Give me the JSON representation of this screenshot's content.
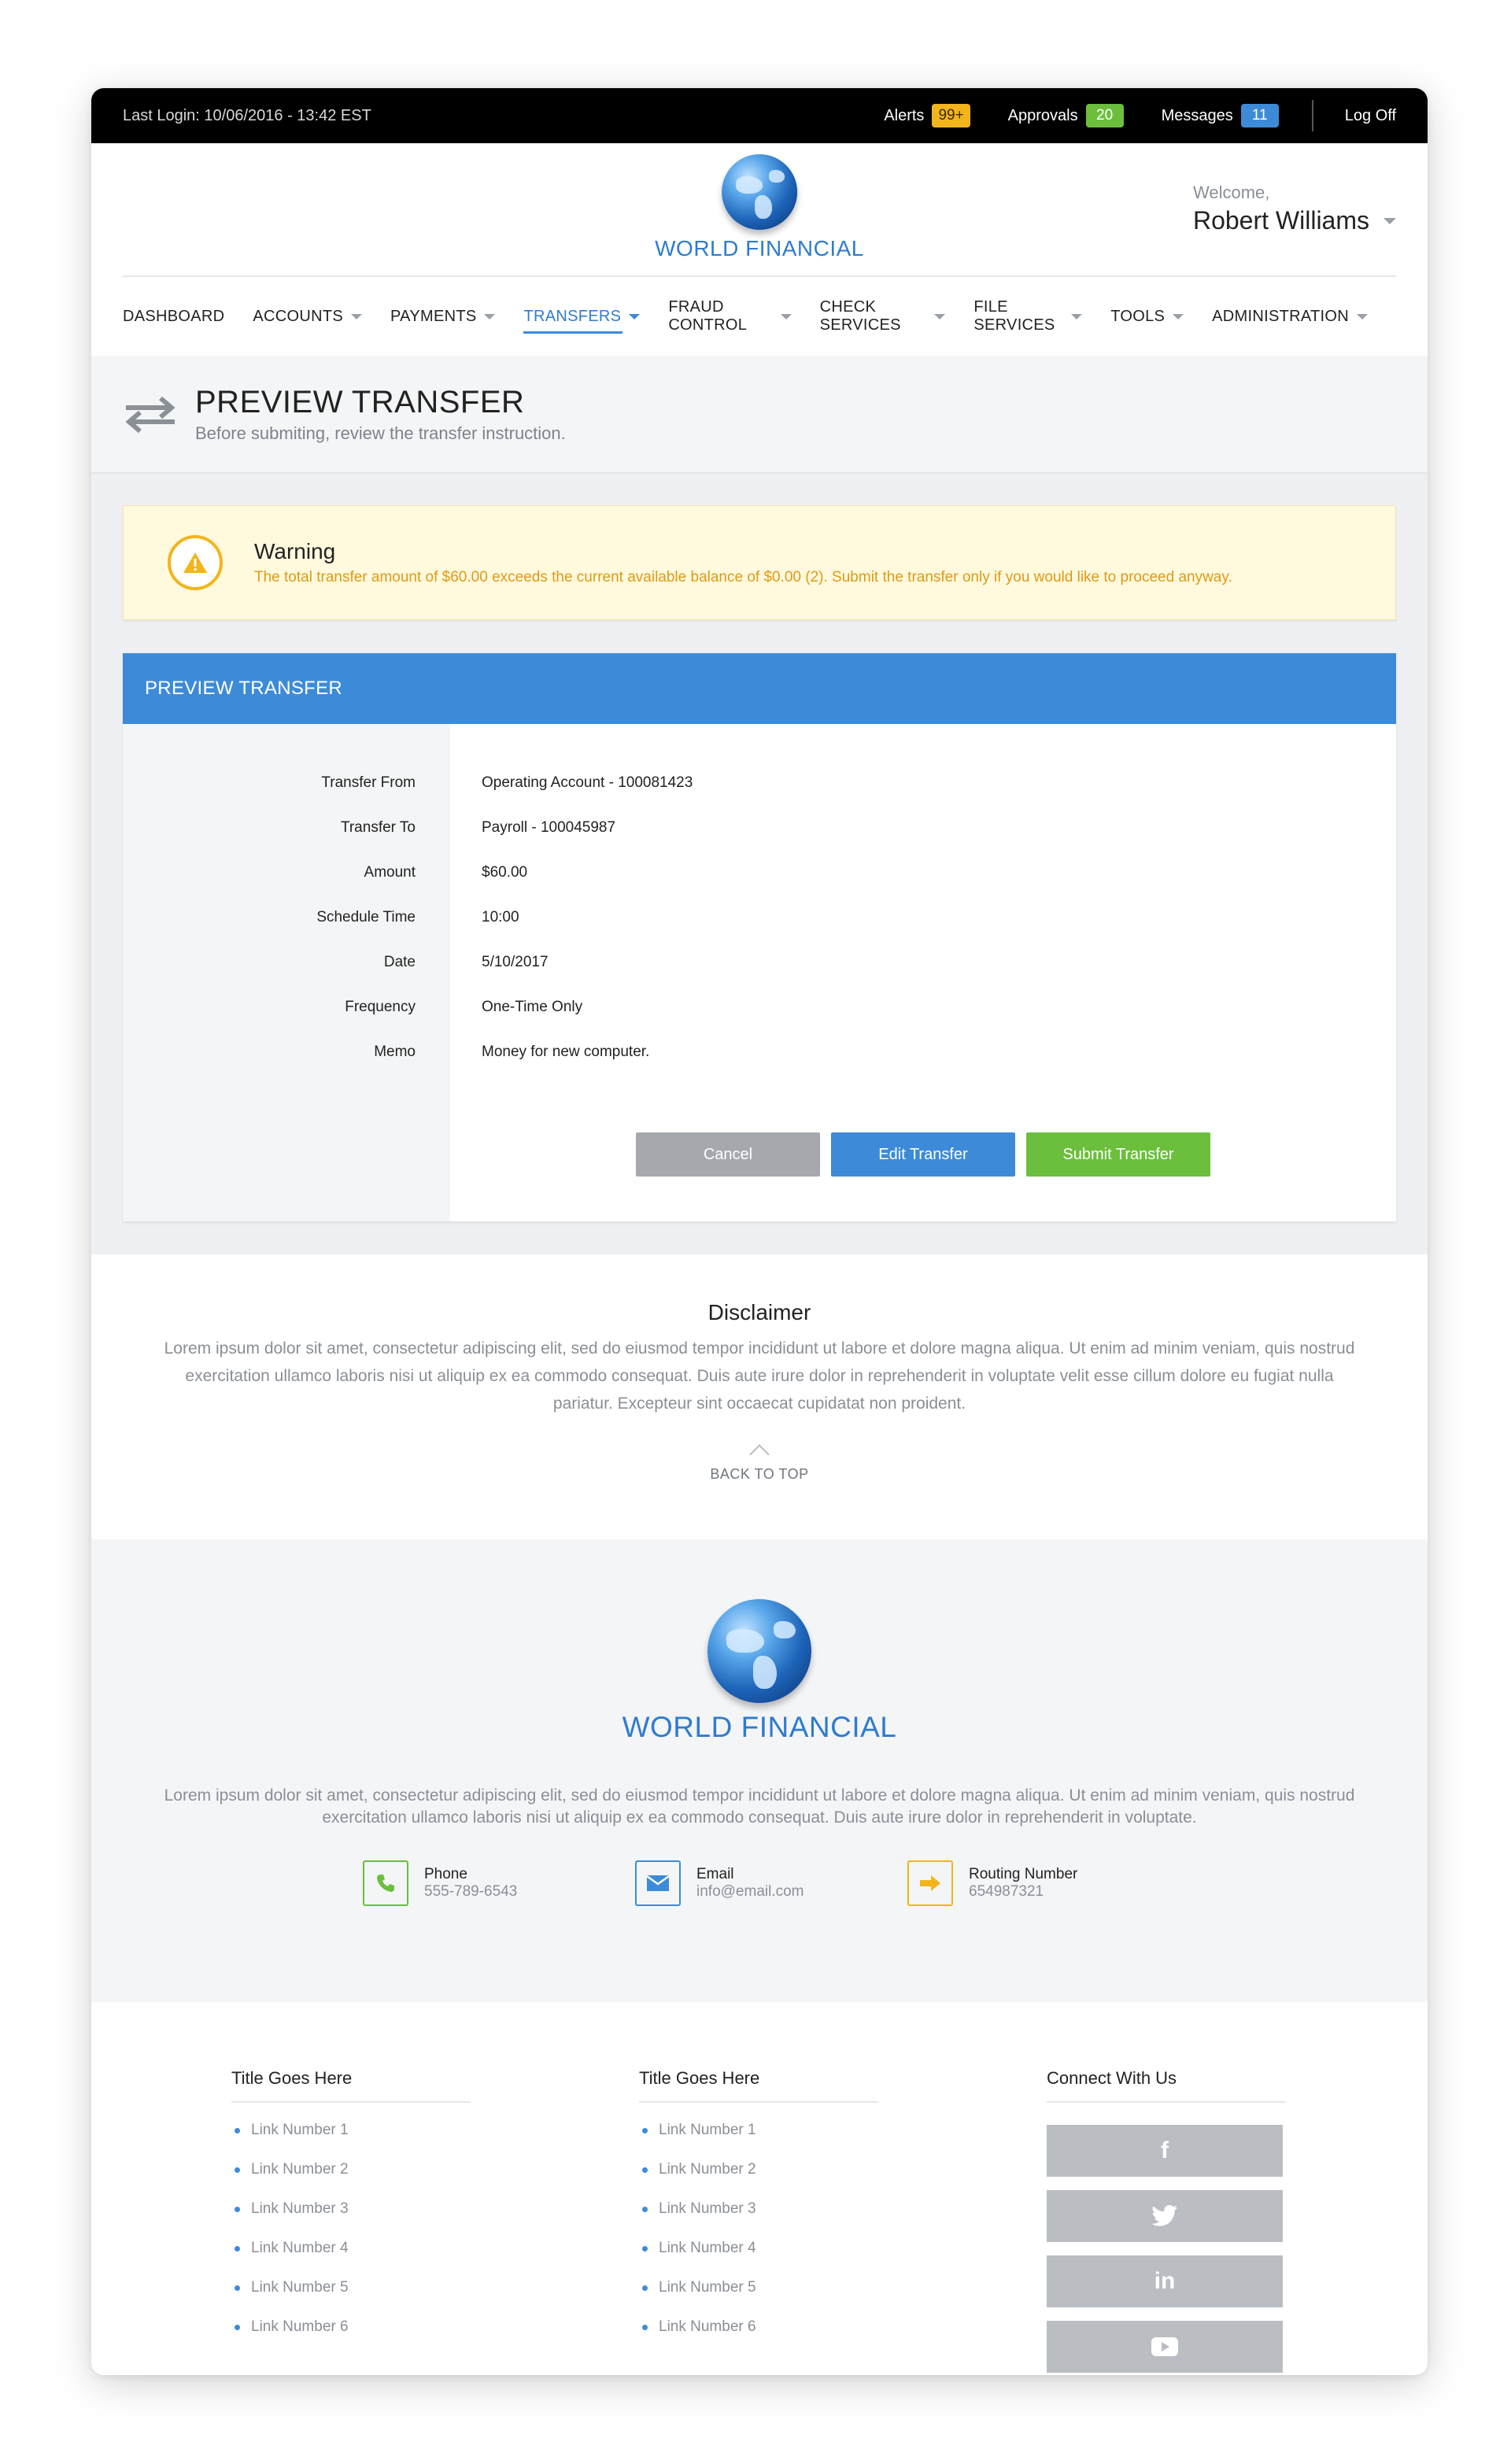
{
  "topbar": {
    "last_login": "Last Login: 10/06/2016 - 13:42 EST",
    "alerts_label": "Alerts",
    "alerts_count": "99+",
    "approvals_label": "Approvals",
    "approvals_count": "20",
    "messages_label": "Messages",
    "messages_count": "11",
    "logoff_label": "Log Off"
  },
  "header": {
    "brand": "WORLD FINANCIAL",
    "welcome": "Welcome,",
    "user_name": "Robert Williams"
  },
  "nav": {
    "items": [
      {
        "label": "DASHBOARD"
      },
      {
        "label": "ACCOUNTS"
      },
      {
        "label": "PAYMENTS"
      },
      {
        "label": "TRANSFERS"
      },
      {
        "label": "FRAUD CONTROL"
      },
      {
        "label": "CHECK SERVICES"
      },
      {
        "label": "FILE SERVICES"
      },
      {
        "label": "TOOLS"
      },
      {
        "label": "ADMINISTRATION"
      }
    ]
  },
  "page": {
    "title": "PREVIEW TRANSFER",
    "subtitle": "Before submiting, review the transfer instruction."
  },
  "warning": {
    "title": "Warning",
    "text": "The total transfer amount of $60.00 exceeds the current available balance of $0.00 (2). Submit the transfer only if you would like to proceed anyway."
  },
  "panel": {
    "title": "PREVIEW TRANSFER",
    "fields": [
      {
        "label": "Transfer From",
        "value": "Operating Account - 100081423"
      },
      {
        "label": "Transfer To",
        "value": "Payroll - 100045987"
      },
      {
        "label": "Amount",
        "value": "$60.00"
      },
      {
        "label": "Schedule Time",
        "value": "10:00"
      },
      {
        "label": "Date",
        "value": "5/10/2017"
      },
      {
        "label": "Frequency",
        "value": "One-Time Only"
      },
      {
        "label": "Memo",
        "value": "Money for new computer."
      }
    ],
    "cancel_label": "Cancel",
    "edit_label": "Edit Transfer",
    "submit_label": "Submit Transfer"
  },
  "disclaimer": {
    "title": "Disclaimer",
    "text": "Lorem ipsum dolor sit amet, consectetur adipiscing elit, sed do eiusmod tempor incididunt ut labore et dolore magna aliqua. Ut enim ad minim veniam, quis nostrud exercitation ullamco laboris nisi ut aliquip ex ea commodo consequat. Duis aute irure dolor in reprehenderit in voluptate velit esse cillum dolore eu fugiat nulla pariatur. Excepteur sint occaecat cupidatat non proident.",
    "back_to_top": "BACK TO TOP"
  },
  "footer": {
    "brand": "WORLD FINANCIAL",
    "text": "Lorem ipsum dolor sit amet, consectetur adipiscing elit, sed do eiusmod tempor incididunt ut labore et dolore magna aliqua. Ut enim ad minim veniam, quis nostrud exercitation ullamco laboris nisi ut aliquip ex ea commodo consequat. Duis aute irure dolor in reprehenderit in voluptate.",
    "contacts": [
      {
        "label": "Phone",
        "value": "555-789-6543",
        "icon": "phone-icon",
        "color": "#6bbf3c"
      },
      {
        "label": "Email",
        "value": "info@email.com",
        "icon": "email-icon",
        "color": "#3d8bd8"
      },
      {
        "label": "Routing Number",
        "value": "654987321",
        "icon": "arrow-right-icon",
        "color": "#f2b51c"
      }
    ],
    "columns": [
      {
        "title": "Title Goes Here",
        "links": [
          "Link Number 1",
          "Link Number 2",
          "Link Number 3",
          "Link Number 4",
          "Link Number 5",
          "Link Number 6"
        ]
      },
      {
        "title": "Title Goes Here",
        "links": [
          "Link Number 1",
          "Link Number 2",
          "Link Number 3",
          "Link Number 4",
          "Link Number 5",
          "Link Number 6"
        ]
      }
    ],
    "social_title": "Connect With Us",
    "social": [
      {
        "icon": "facebook-icon",
        "glyph": "f"
      },
      {
        "icon": "twitter-icon",
        "glyph": "🐦"
      },
      {
        "icon": "linkedin-icon",
        "glyph": "in"
      },
      {
        "icon": "youtube-icon",
        "glyph": "▶"
      }
    ]
  },
  "colors": {
    "brand_blue": "#3d8bd8",
    "alert_yellow": "#f2b51c",
    "success_green": "#6bbf3c",
    "cancel_gray": "#a5a9ae"
  }
}
